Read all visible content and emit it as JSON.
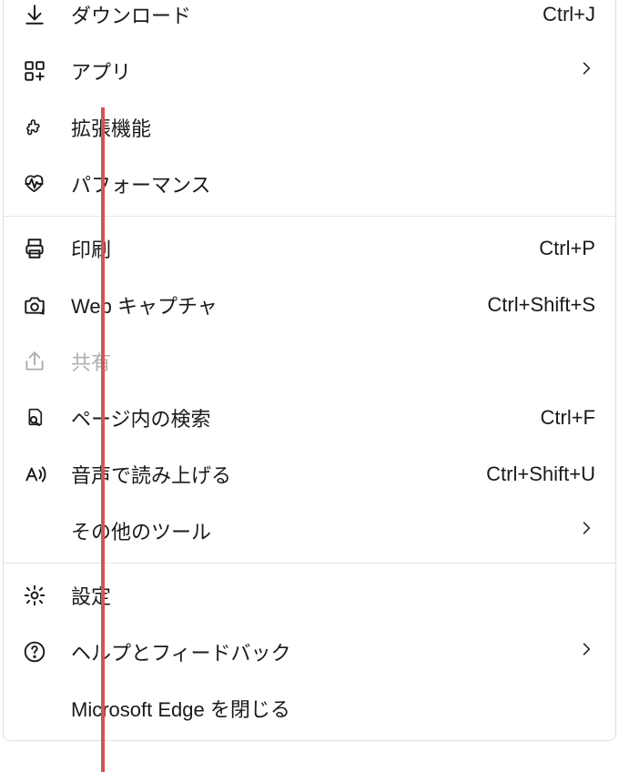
{
  "menu": {
    "items": [
      {
        "key": "downloads",
        "label": "ダウンロード",
        "shortcut": "Ctrl+J",
        "icon": "download-icon",
        "chevron": false,
        "disabled": false
      },
      {
        "key": "apps",
        "label": "アプリ",
        "shortcut": "",
        "icon": "apps-icon",
        "chevron": true,
        "disabled": false
      },
      {
        "key": "extensions",
        "label": "拡張機能",
        "shortcut": "",
        "icon": "puzzle-icon",
        "chevron": false,
        "disabled": false
      },
      {
        "key": "performance",
        "label": "パフォーマンス",
        "shortcut": "",
        "icon": "heartbeat-icon",
        "chevron": false,
        "disabled": false
      },
      {
        "key": "print",
        "label": "印刷",
        "shortcut": "Ctrl+P",
        "icon": "printer-icon",
        "chevron": false,
        "disabled": false
      },
      {
        "key": "webcapture",
        "label": "Web キャプチャ",
        "shortcut": "Ctrl+Shift+S",
        "icon": "camera-icon",
        "chevron": false,
        "disabled": false
      },
      {
        "key": "share",
        "label": "共有",
        "shortcut": "",
        "icon": "share-icon",
        "chevron": false,
        "disabled": true
      },
      {
        "key": "findpage",
        "label": "ページ内の検索",
        "shortcut": "Ctrl+F",
        "icon": "find-icon",
        "chevron": false,
        "disabled": false
      },
      {
        "key": "readaloud",
        "label": "音声で読み上げる",
        "shortcut": "Ctrl+Shift+U",
        "icon": "readaloud-icon",
        "chevron": false,
        "disabled": false
      },
      {
        "key": "moretools",
        "label": "その他のツール",
        "shortcut": "",
        "icon": "",
        "chevron": true,
        "disabled": false
      },
      {
        "key": "settings",
        "label": "設定",
        "shortcut": "",
        "icon": "gear-icon",
        "chevron": false,
        "disabled": false
      },
      {
        "key": "help",
        "label": "ヘルプとフィードバック",
        "shortcut": "",
        "icon": "help-icon",
        "chevron": true,
        "disabled": false
      },
      {
        "key": "close",
        "label": "Microsoft Edge を閉じる",
        "shortcut": "",
        "icon": "",
        "chevron": false,
        "disabled": false
      }
    ]
  },
  "annotation": {
    "red_line_color": "#d9534f"
  }
}
